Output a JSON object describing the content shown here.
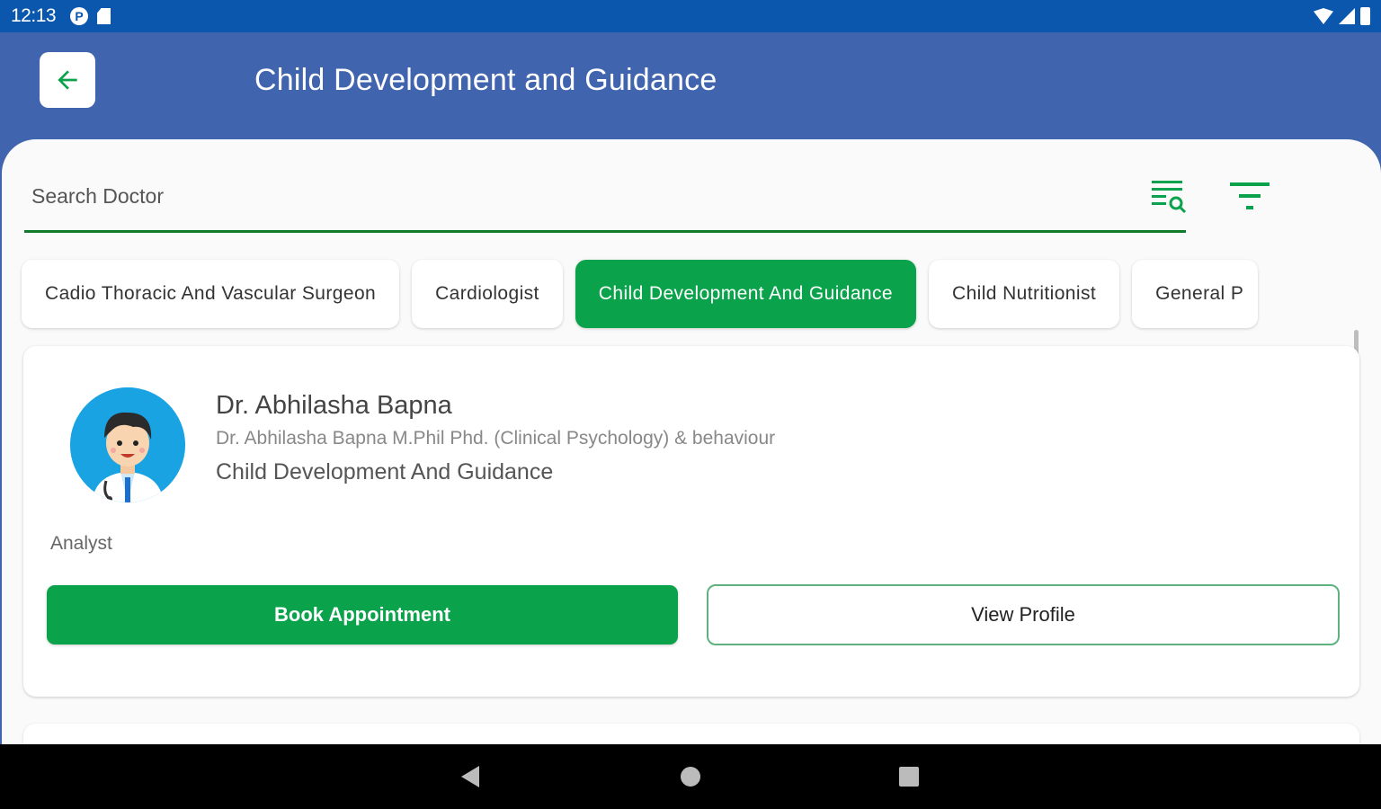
{
  "status_bar": {
    "time": "12:13",
    "icons": [
      "p-icon",
      "sd-card-icon",
      "wifi-icon",
      "signal-icon",
      "battery-icon"
    ]
  },
  "header": {
    "title": "Child Development and Guidance",
    "back_icon": "arrow-left-icon"
  },
  "search": {
    "placeholder": "Search Doctor",
    "icons": [
      "search-list-icon",
      "filter-icon"
    ]
  },
  "categories": [
    {
      "label": "Cadio Thoracic And Vascular Surgeon",
      "active": false
    },
    {
      "label": "Cardiologist",
      "active": false
    },
    {
      "label": "Child Development And Guidance",
      "active": true
    },
    {
      "label": "Child Nutritionist",
      "active": false
    },
    {
      "label": "General P",
      "active": false
    }
  ],
  "doctor": {
    "name": "Dr. Abhilasha Bapna",
    "qualification": "Dr. Abhilasha Bapna M.Phil Phd. (Clinical Psychology) & behaviour",
    "specialty": "Child Development And Guidance",
    "role": "Analyst",
    "book_label": "Book Appointment",
    "view_label": "View Profile"
  },
  "colors": {
    "primary_blue": "#4164ae",
    "status_blue": "#0a57ad",
    "accent_green": "#0aa24a",
    "underline_green": "#0f7a2a"
  }
}
